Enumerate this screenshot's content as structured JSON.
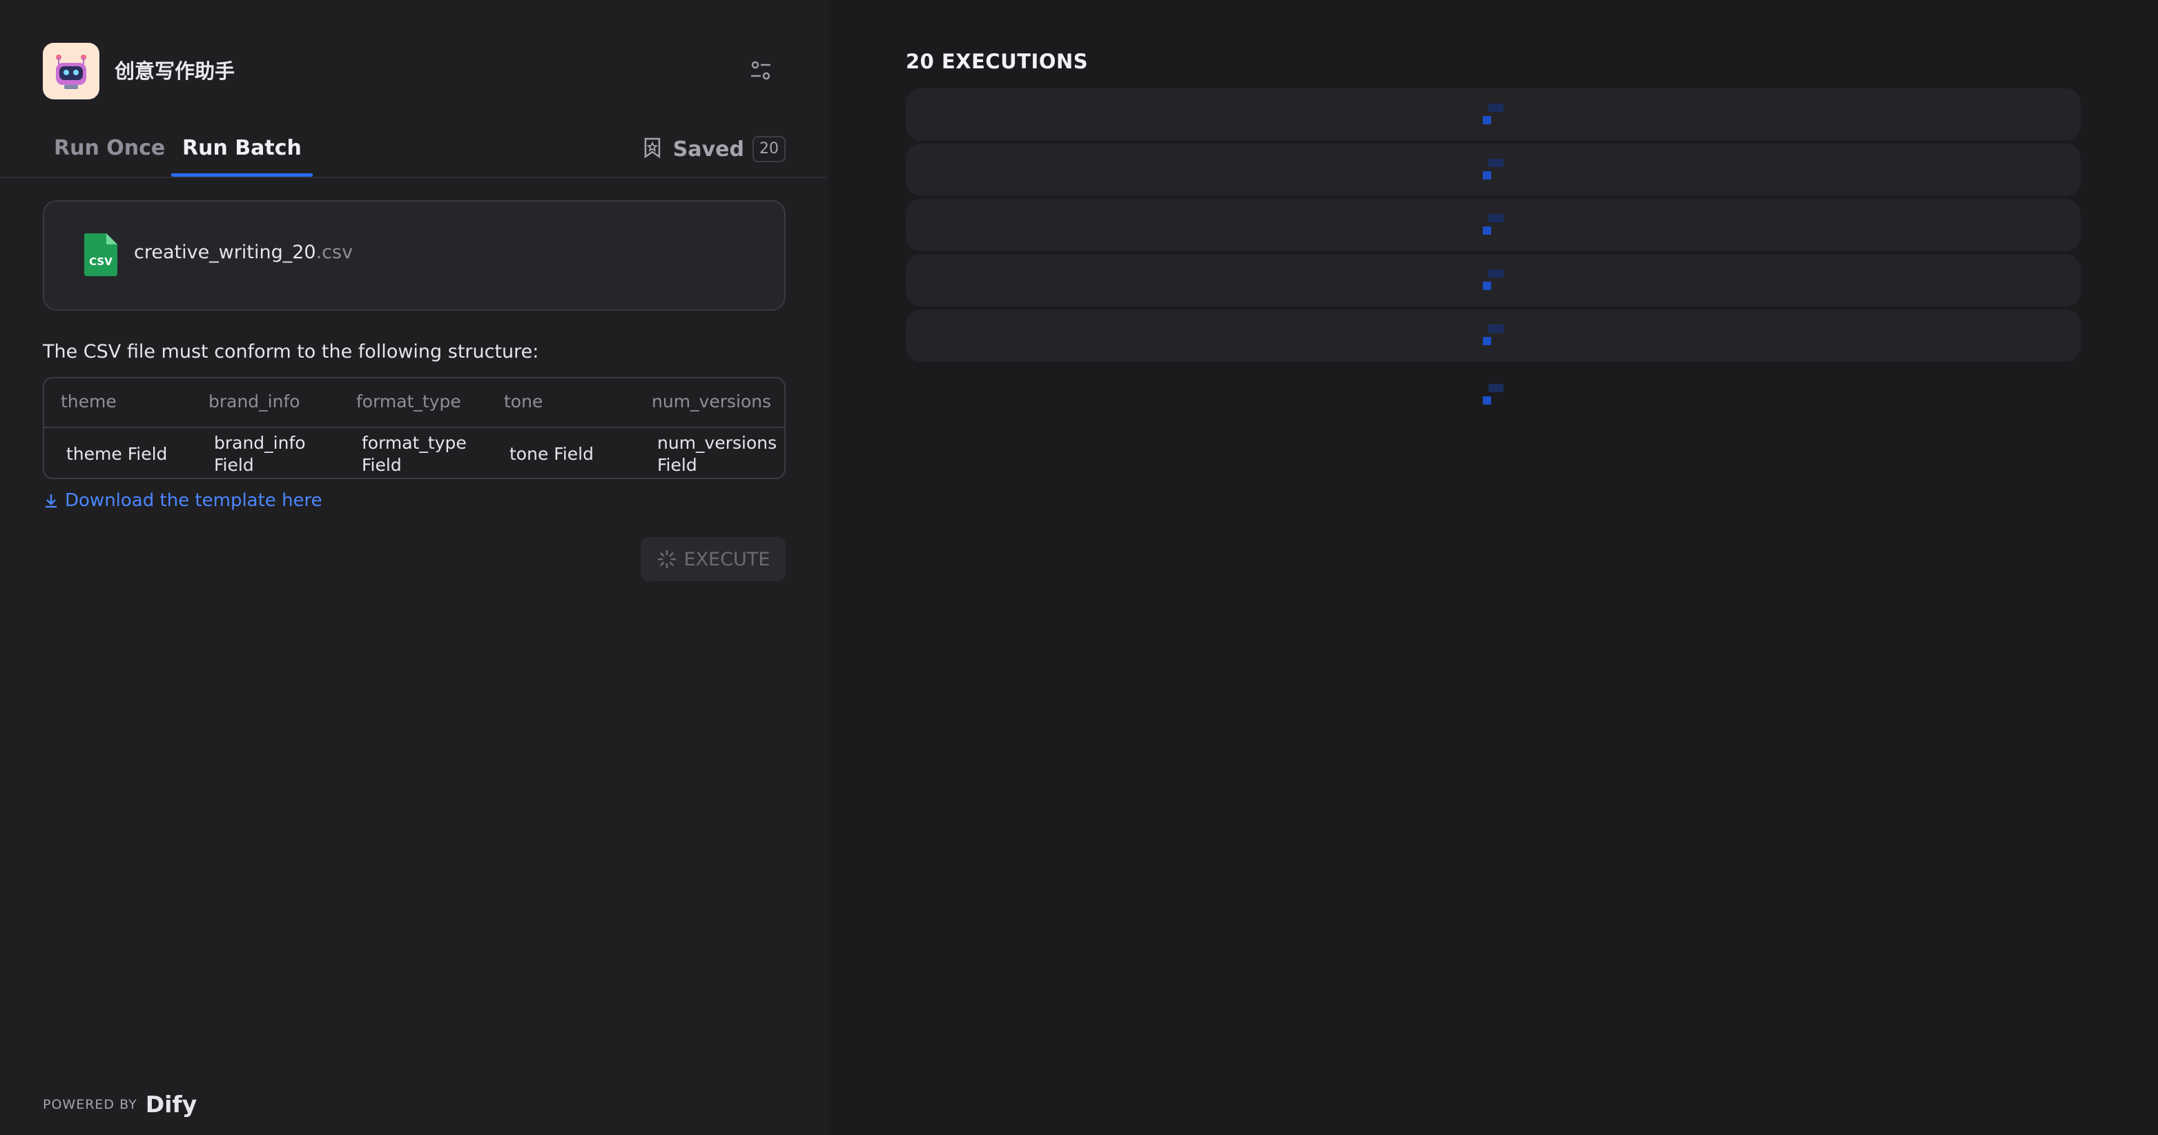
{
  "app": {
    "title": "创意写作助手"
  },
  "tabs": {
    "run_once": "Run Once",
    "run_batch": "Run Batch",
    "active": "run_batch"
  },
  "saved": {
    "label": "Saved",
    "count": "20"
  },
  "file": {
    "name": "creative_writing_20",
    "ext": ".csv",
    "icon_label": "CSV"
  },
  "structure_text": "The CSV file must conform to the following structure:",
  "table": {
    "headers": [
      "theme",
      "brand_info",
      "format_type",
      "tone",
      "num_versions"
    ],
    "row": [
      [
        "theme Field"
      ],
      [
        "brand_info",
        "Field"
      ],
      [
        "format_type",
        "Field"
      ],
      [
        "tone Field"
      ],
      [
        "num_versions",
        "Field"
      ]
    ]
  },
  "download_label": "Download the template here",
  "execute_label": "EXECUTE",
  "powered_by": {
    "label": "POWERED BY",
    "brand": "Dify"
  },
  "results": {
    "title": "20 EXECUTIONS",
    "loading_rows": 5
  },
  "colors": {
    "accent": "#2d6bf4",
    "link": "#4b87ff",
    "csv_green": "#1f9d55"
  }
}
